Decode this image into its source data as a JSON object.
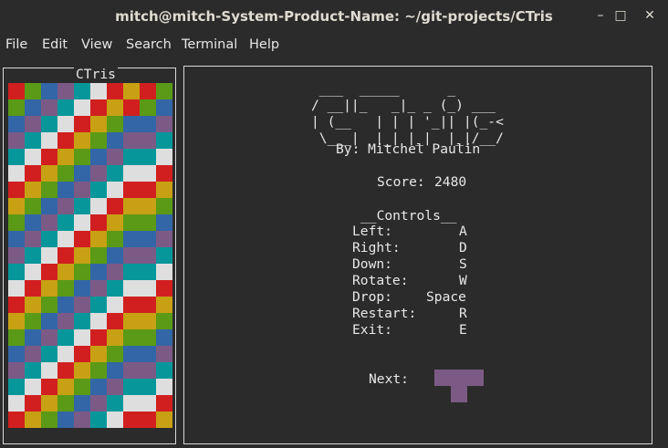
{
  "window": {
    "title": "mitch@mitch-System-Product-Name: ~/git-projects/CTris",
    "minimize_glyph": "–",
    "maximize_glyph": "□",
    "close_glyph": "✕"
  },
  "menu": [
    "File",
    "Edit",
    "View",
    "Search",
    "Terminal",
    "Help"
  ],
  "game": {
    "board_title": "CTris",
    "logo_lines": [
      " ___  _____      _",
      "/ __||_   _|_ _ (_) ___",
      "| (__   | | | '_|| |(_-<",
      " \\___|  |_| |_|  |_|/__/"
    ],
    "byline": "By: Mitchel Paulin",
    "score_label": "Score:",
    "score": "2480",
    "controls_title": "__Controls__",
    "controls": [
      {
        "action": "Left:",
        "key": "A"
      },
      {
        "action": "Right:",
        "key": "D"
      },
      {
        "action": "Down:",
        "key": "S"
      },
      {
        "action": "Rotate:",
        "key": "W"
      },
      {
        "action": "Drop:",
        "key": "Space"
      },
      {
        "action": "Restart:",
        "key": "R"
      },
      {
        "action": "Exit:",
        "key": "E"
      }
    ],
    "next_label": "Next:",
    "next_piece": "T",
    "next_piece_color": "#7c5a86"
  },
  "colors": {
    "red": "#d11f1f",
    "green": "#5a9a16",
    "blue": "#3366a6",
    "purple": "#7c5a86",
    "cyan": "#07979a",
    "white": "#dedede",
    "yellow": "#c7a113"
  },
  "board": {
    "rows": [
      "rgbpcwry",
      "gbpcwryr",
      "bpcwrygb",
      "pcwrygbp",
      "cwrygbpc",
      "wrygbpcw",
      "rygbpcwr",
      "ygbpcwry",
      "gbpcwryg",
      "bpcwrygb",
      "pcwrygbp",
      "cwrygbpc",
      "wrygbpcw",
      "rygbpcwr",
      "ygbpcwry",
      "gbpcwryg",
      "bpcwrygb",
      "pcwrygbp",
      "cwrygbpc",
      "wrygbpcw",
      "rygbpcwr"
    ]
  }
}
